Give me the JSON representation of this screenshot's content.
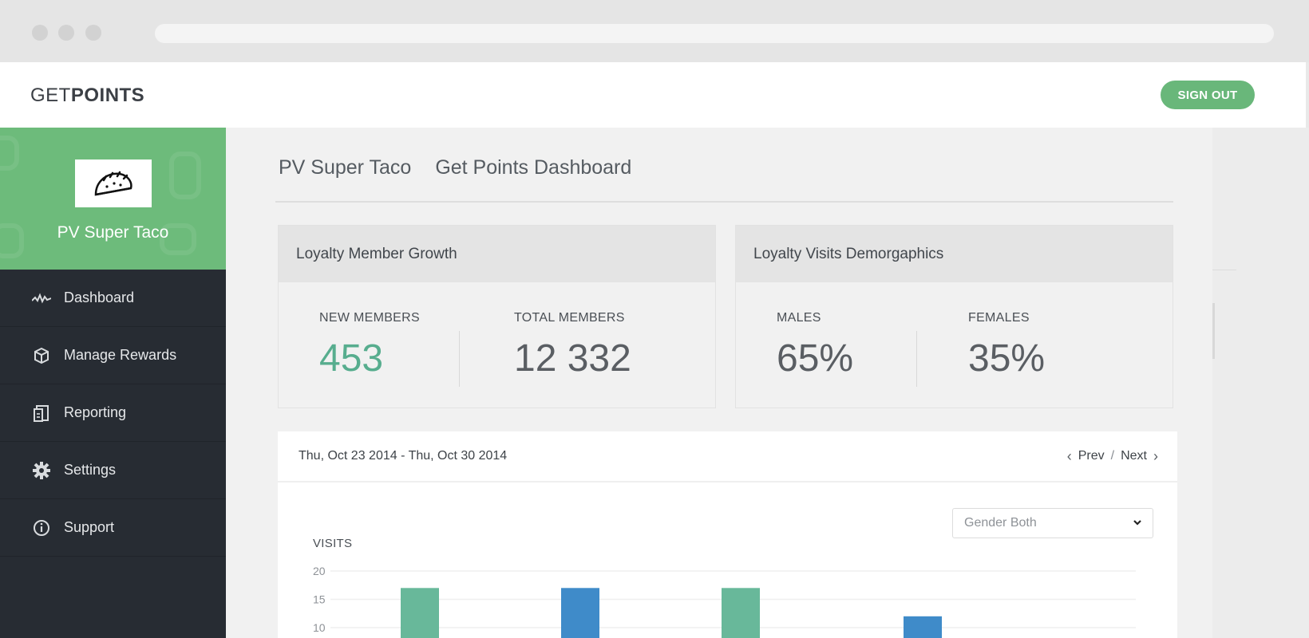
{
  "header": {
    "logo_light": "GET",
    "logo_bold": "POINTS",
    "signout_label": "SIGN OUT"
  },
  "sidebar": {
    "brand_name": "PV Super Taco",
    "items": [
      {
        "label": "Dashboard",
        "icon": "activity-icon"
      },
      {
        "label": "Manage Rewards",
        "icon": "gift-icon"
      },
      {
        "label": "Reporting",
        "icon": "report-icon"
      },
      {
        "label": "Settings",
        "icon": "gear-icon"
      },
      {
        "label": "Support",
        "icon": "info-icon"
      }
    ]
  },
  "main": {
    "title_store": "PV Super Taco",
    "title_page": "Get Points Dashboard",
    "growth": {
      "title": "Loyalty Member Growth",
      "new_label": "NEW MEMBERS",
      "new_value": "453",
      "total_label": "TOTAL MEMBERS",
      "total_value": "12 332"
    },
    "demographics": {
      "title": "Loyalty Visits Demorgaphics",
      "males_label": "MALES",
      "males_value": "65%",
      "females_label": "FEMALES",
      "females_value": "35%"
    },
    "chart_panel": {
      "date_range": "Thu, Oct 23 2014 - Thu, Oct 30 2014",
      "prev": "Prev",
      "separator": "/",
      "next": "Next",
      "gender_select": "Gender Both",
      "visits_label": "VISITS"
    },
    "colors": {
      "accent": "#6dbb7b",
      "green_bar": "#68b89a",
      "blue_bar": "#3f8bc9"
    }
  },
  "chart_data": {
    "type": "bar",
    "ylabel": "VISITS",
    "yticks": [
      20,
      15,
      10
    ],
    "ylim": [
      0,
      20
    ],
    "series": [
      {
        "color": "#68b89a",
        "values": [
          17,
          null,
          17,
          null
        ]
      },
      {
        "color": "#3f8bc9",
        "values": [
          null,
          17,
          null,
          12
        ]
      }
    ],
    "values": [
      17,
      17,
      17,
      12
    ],
    "bar_colors": [
      "#68b89a",
      "#3f8bc9",
      "#68b89a",
      "#3f8bc9"
    ]
  }
}
